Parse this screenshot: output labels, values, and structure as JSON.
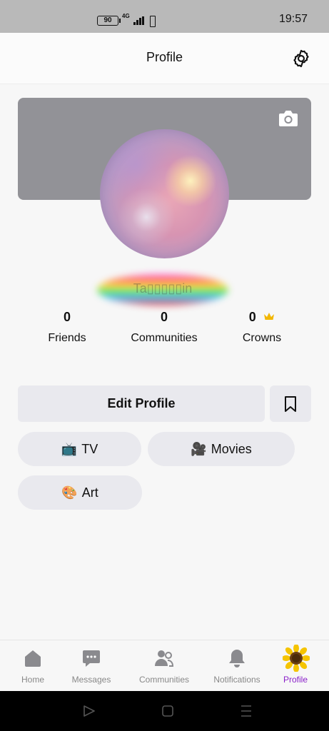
{
  "status_bar": {
    "battery": "90",
    "network": "4G",
    "time": "19:57",
    "icons": [
      "battery-icon",
      "signal-icon",
      "vibrate-icon"
    ]
  },
  "header": {
    "title": "Profile",
    "settings_icon": "gear-icon"
  },
  "cover": {
    "camera_icon": "camera-icon",
    "color": "#929297"
  },
  "profile": {
    "name": "Ta▯▯▯▯▯in"
  },
  "stats": [
    {
      "value": "0",
      "label": "Friends"
    },
    {
      "value": "0",
      "label": "Communities"
    },
    {
      "value": "0",
      "label": "Crowns",
      "icon": "crown-icon"
    }
  ],
  "actions": {
    "edit_profile": "Edit Profile",
    "bookmark_icon": "bookmark-icon"
  },
  "interests": [
    {
      "emoji": "📺",
      "label": "TV"
    },
    {
      "emoji": "🎥",
      "label": "Movies"
    },
    {
      "emoji": "🎨",
      "label": "Art"
    }
  ],
  "bottom_nav": [
    {
      "label": "Home",
      "icon": "home-icon"
    },
    {
      "label": "Messages",
      "icon": "chat-icon"
    },
    {
      "label": "Communities",
      "icon": "people-icon"
    },
    {
      "label": "Notifications",
      "icon": "bell-icon"
    },
    {
      "label": "Profile",
      "icon": "sunflower-avatar-icon",
      "active": true
    }
  ],
  "system_nav": [
    "back-icon",
    "home-square-icon",
    "recents-icon"
  ],
  "colors": {
    "accent": "#8a1fc9",
    "crown": "#f2b705",
    "chip_bg": "#e9e9ee"
  }
}
